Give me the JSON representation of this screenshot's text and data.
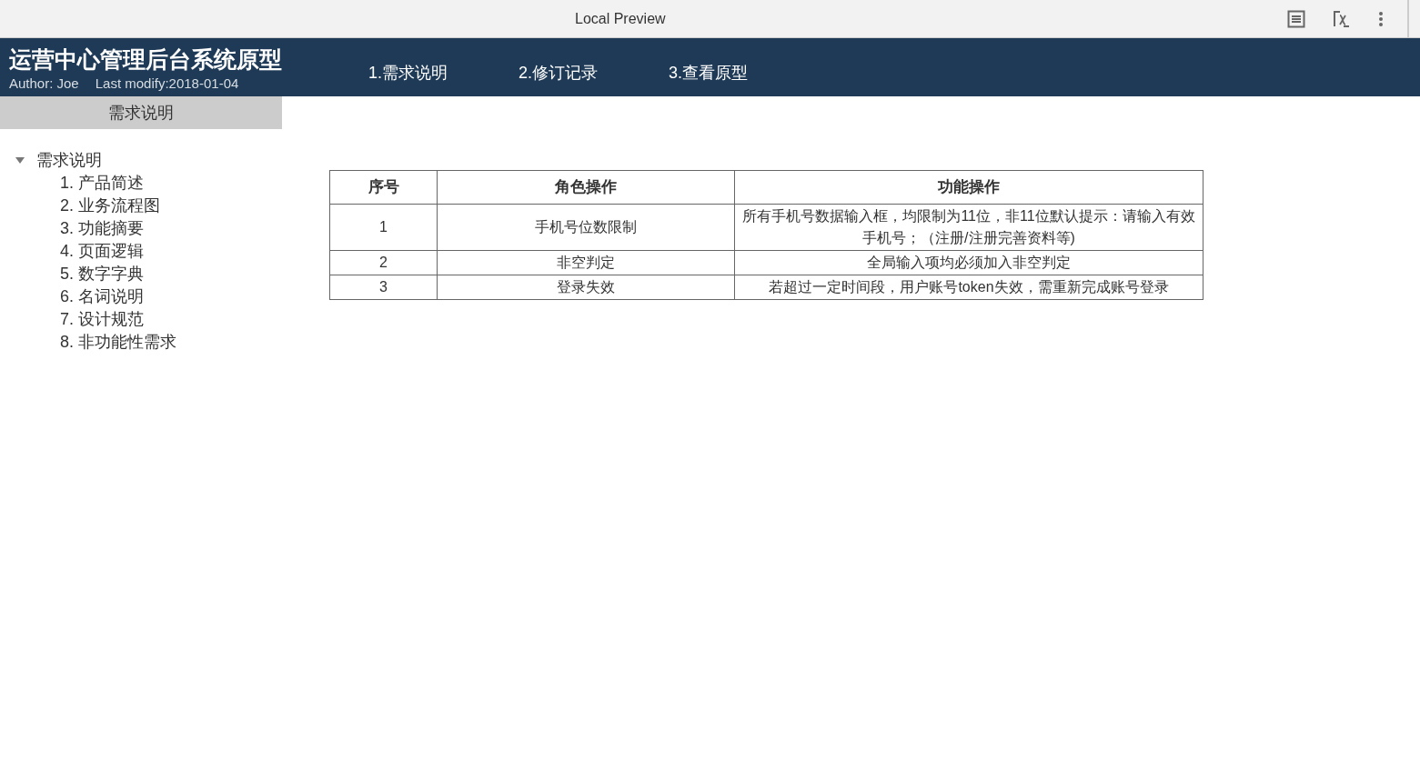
{
  "window": {
    "title": "Local Preview"
  },
  "header": {
    "title": "运营中心管理后台系统原型",
    "author": "Author: Joe",
    "modified": "Last modify:2018-01-04"
  },
  "nav_tabs": [
    {
      "label": "1.需求说明"
    },
    {
      "label": "2.修订记录"
    },
    {
      "label": "3.查看原型"
    }
  ],
  "sidebar": {
    "heading": "需求说明",
    "tree": [
      {
        "label": "需求说明",
        "expanded": true,
        "children": [
          {
            "label": "1. 产品简述"
          },
          {
            "label": "2. 业务流程图"
          },
          {
            "label": "3. 功能摘要"
          },
          {
            "label": "4. 页面逻辑"
          },
          {
            "label": "5. 数字字典"
          },
          {
            "label": "6. 名词说明"
          },
          {
            "label": "7. 设计规范"
          },
          {
            "label": "8. 非功能性需求"
          }
        ]
      }
    ]
  },
  "table": {
    "columns": [
      "序号",
      "角色操作",
      "功能操作"
    ],
    "rows": [
      [
        "1",
        "手机号位数限制",
        "所有手机号数据输入框，均限制为11位，非11位默认提示：请输入有效手机号；（注册/注册完善资料等)"
      ],
      [
        "2",
        "非空判定",
        "全局输入项均必须加入非空判定"
      ],
      [
        "3",
        "登录失效",
        "若超过一定时间段，用户账号token失效，需重新完成账号登录"
      ]
    ]
  }
}
